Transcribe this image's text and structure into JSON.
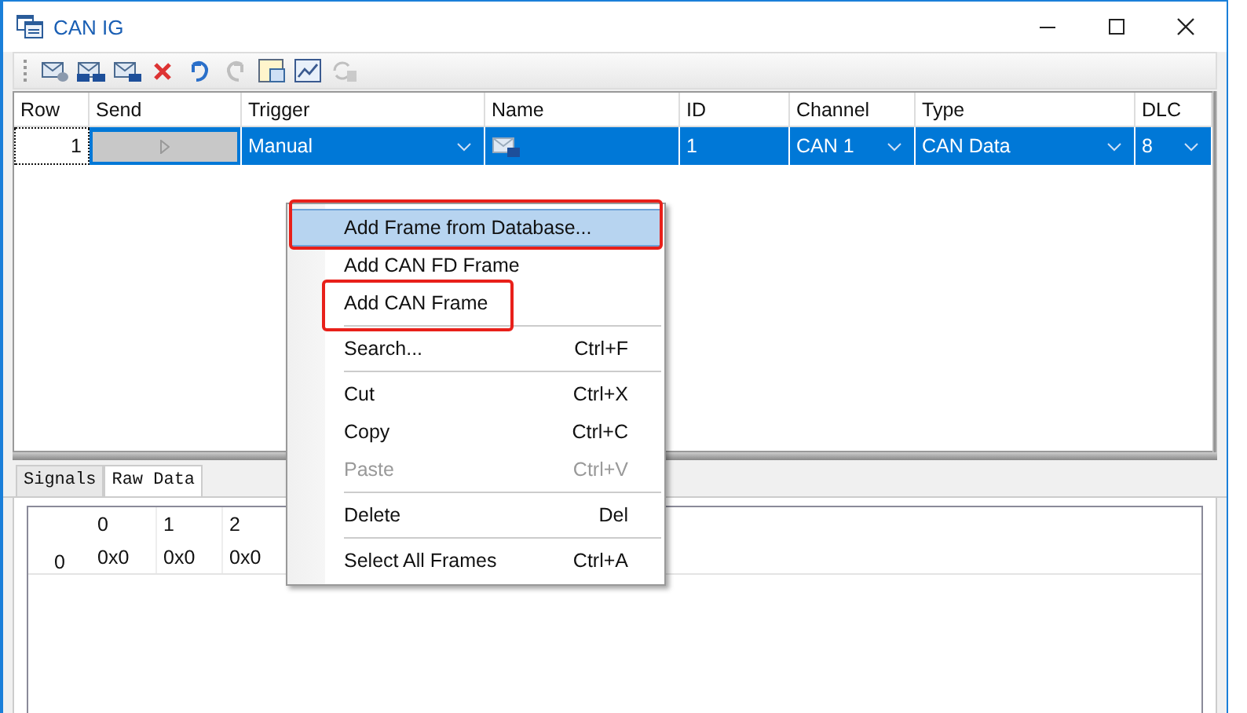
{
  "window": {
    "title": "CAN IG"
  },
  "toolbar": [
    {
      "kind": "database",
      "disabled": false
    },
    {
      "kind": "fd",
      "disabled": false
    },
    {
      "kind": "id",
      "disabled": false
    },
    {
      "kind": "delete",
      "disabled": false
    },
    {
      "kind": "undo",
      "disabled": false
    },
    {
      "kind": "redo",
      "disabled": true
    },
    {
      "kind": "window",
      "disabled": false
    },
    {
      "kind": "chart",
      "disabled": false
    },
    {
      "kind": "refresh",
      "disabled": true
    }
  ],
  "grid": {
    "columns": [
      "Row",
      "Send",
      "Trigger",
      "Name",
      "ID",
      "Channel",
      "Type",
      "DLC"
    ],
    "rows": [
      {
        "selected": true,
        "row": "1",
        "trigger": "Manual",
        "id": "1",
        "channel": "CAN 1",
        "type": "CAN Data",
        "dlc": "8"
      }
    ]
  },
  "context_menu": {
    "items": [
      {
        "label": "Add Frame from Database...",
        "selected": true,
        "disabled": false,
        "separator_before": false,
        "outlined": true
      },
      {
        "label": "Add CAN FD Frame",
        "selected": false,
        "disabled": false,
        "separator_before": false,
        "outlined": false
      },
      {
        "label": "Add CAN Frame",
        "selected": false,
        "disabled": false,
        "separator_before": false,
        "outlined": true
      },
      {
        "label": "Search...",
        "shortcut": "Ctrl+F",
        "selected": false,
        "disabled": false,
        "separator_before": true,
        "outlined": false
      },
      {
        "label": "Cut",
        "shortcut": "Ctrl+X",
        "selected": false,
        "disabled": false,
        "separator_before": true,
        "outlined": false
      },
      {
        "label": "Copy",
        "shortcut": "Ctrl+C",
        "selected": false,
        "disabled": false,
        "separator_before": false,
        "outlined": false
      },
      {
        "label": "Paste",
        "shortcut": "Ctrl+V",
        "selected": false,
        "disabled": true,
        "separator_before": false,
        "outlined": false
      },
      {
        "label": "Delete",
        "shortcut": "Del",
        "selected": false,
        "disabled": false,
        "separator_before": true,
        "outlined": false
      },
      {
        "label": "Select All Frames",
        "shortcut": "Ctrl+A",
        "selected": false,
        "disabled": false,
        "separator_before": true,
        "outlined": false
      }
    ]
  },
  "bottom_tabs": [
    {
      "label": "Signals",
      "selected": false
    },
    {
      "label": "Raw Data",
      "selected": true
    }
  ],
  "raw_data": {
    "columns": [
      "0",
      "1",
      "2"
    ],
    "rows": [
      {
        "label": "0",
        "values": [
          "0x0",
          "0x0",
          "0x0"
        ]
      }
    ]
  }
}
